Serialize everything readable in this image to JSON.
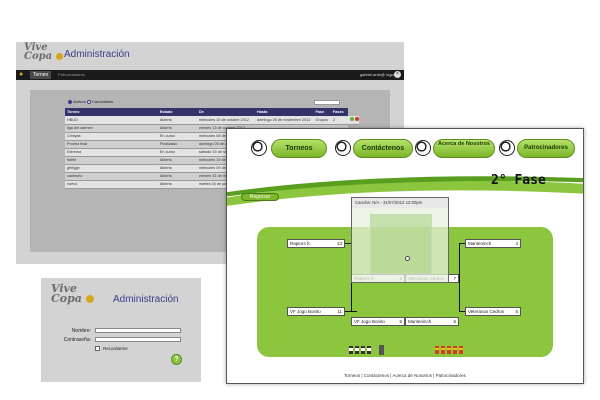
{
  "admin": {
    "logo_line1": "Vive",
    "logo_line2": "Copa",
    "title": "Administración",
    "nav": {
      "tab_active": "Torneo",
      "tab_other": "Patrocinadores",
      "user": "gabriel.anto@ logout"
    },
    "filters": {
      "option_active": "Activos",
      "option_cancelled": "Cancelados"
    },
    "table": {
      "headers": [
        "Torneo",
        "Estado",
        "De",
        "Hasta",
        "Fase",
        "Fases"
      ],
      "rows": [
        [
          "HBUD",
          "Abierto",
          "miércoles 10 de octubre 2012",
          "domingo 25 de noviembre 2012",
          "Grupos",
          "2"
        ],
        [
          "liga del carmen",
          "Abierto",
          "viernes 13 de octubre 2012",
          "",
          "",
          ""
        ],
        [
          "Cimiyas",
          "En curso",
          "miércoles 08 de agosto 2012",
          "",
          "",
          ""
        ],
        [
          "Prueba final",
          "Finalizado",
          "domingo 05 de agosto 2012",
          "",
          "",
          ""
        ],
        [
          "Extrema",
          "En curso",
          "sábado 15 de septiembre",
          "",
          "",
          ""
        ],
        [
          "fsfefe",
          "Abierto",
          "miércoles 19 de enero",
          "",
          "",
          ""
        ],
        [
          "gfhfggh",
          "Abierto",
          "miércoles 09 de enero",
          "",
          "",
          ""
        ],
        [
          "canfinelo",
          "Abierto",
          "viernes 31 de mayo",
          "",
          "",
          ""
        ],
        [
          "nuevo",
          "Abierto",
          "martes 04 de junio",
          "",
          "",
          ""
        ]
      ]
    }
  },
  "login": {
    "logo_line1": "Vive",
    "logo_line2": "Copa",
    "title": "Administración",
    "user_label": "Nombre:",
    "password_label": "Contraseña:",
    "remember_label": "Recordarme",
    "submit_icon": "question-icon"
  },
  "front": {
    "nav": [
      "Torneos",
      "Contáctenos",
      "Acerca de Nosotros",
      "Patrocinadores"
    ],
    "phase_title": "2° Fase",
    "back_button": "Regresar",
    "match_popup": "Cancha: N/A - 31/07/2012 12:00pm",
    "bracket": {
      "left_r1_a": {
        "team": "Raptors fc",
        "score": "13"
      },
      "left_r1_b": {
        "team": "VF Jogo Bonito",
        "score": "11"
      },
      "left_r2_a": {
        "team": "Raptors fc",
        "score": "2"
      },
      "left_r2_b": {
        "team": "VF Jogo Bonito",
        "score": "5"
      },
      "right_r2_a": {
        "team": "Veteranos Cedros",
        "score": "7"
      },
      "right_r2_b": {
        "team": "Manteninch",
        "score": "6"
      },
      "right_r1_a": {
        "team": "Manteninch",
        "score": "4"
      },
      "right_r1_b": {
        "team": "Veteranos Cedros",
        "score": "5"
      }
    },
    "footer": "Torneos | Contáctenos | Acerca de Nosotros | Patrocinadores"
  },
  "colors": {
    "admin_bg": "#d3d3d3",
    "admin_title": "#3c3c8c",
    "header_bar": "#1a1a1a",
    "field_green": "#8cc63f",
    "button_green": "#7cb629"
  }
}
